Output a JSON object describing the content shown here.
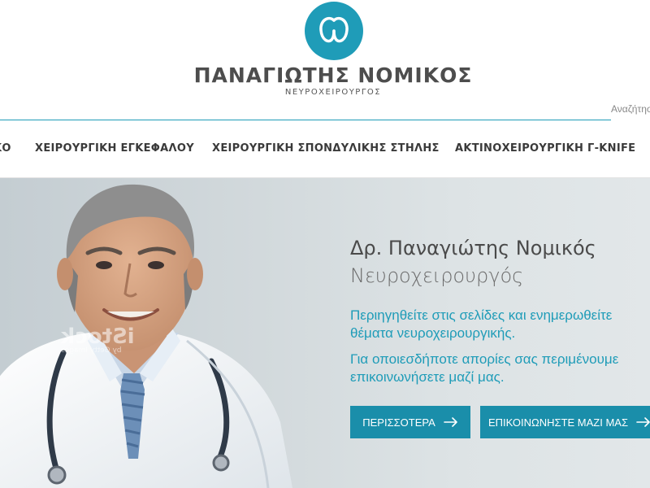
{
  "header": {
    "logo_icon": "brain-icon",
    "brand_name": "ΠΑΝΑΓΙΩΤΗΣ ΝΟΜΙΚΟΣ",
    "brand_subtitle": "ΝΕΥΡΟΧΕΙΡΟΥΡΓΟΣ",
    "search_placeholder": "Αναζήτηση"
  },
  "nav": {
    "items": [
      {
        "label": "ΚΟ"
      },
      {
        "label": "ΧΕΙΡΟΥΡΓΙΚΗ ΕΓΚΕΦΑΛΟΥ"
      },
      {
        "label": "ΧΕΙΡΟΥΡΓΙΚΗ ΣΠΟΝΔΥΛΙΚΗΣ ΣΤΗΛΗΣ"
      },
      {
        "label": "ΑΚΤΙΝΟΧΕΙΡΟΥΡΓΙΚΗ Γ-KNIFE"
      }
    ]
  },
  "hero": {
    "title": "Δρ. Παναγιώτης Νομικός",
    "subtitle": "Νευροχειρουργός",
    "text_lines": [
      "Περιηγηθείτε στις σελίδες και ενημερωθείτε",
      "θέματα νευροχειρουργικής.",
      "Για οποιεσδήποτε απορίες σας περιμένουμε",
      "επικοινωνήσετε μαζί μας."
    ],
    "watermark": "iStock",
    "watermark_sub": "by Getty Images",
    "buttons": {
      "more": "ΠΕΡΙΣΣΟΤΕΡΑ",
      "contact": "ΕΠΙΚΟΙΝΩΝΗΣΤΕ ΜΑΖΙ ΜΑΣ",
      "arrow_icon": "arrow-right-icon"
    }
  },
  "colors": {
    "accent": "#1f9cb8",
    "button": "#1a8eaa",
    "hero_background": "#d6dde0"
  }
}
